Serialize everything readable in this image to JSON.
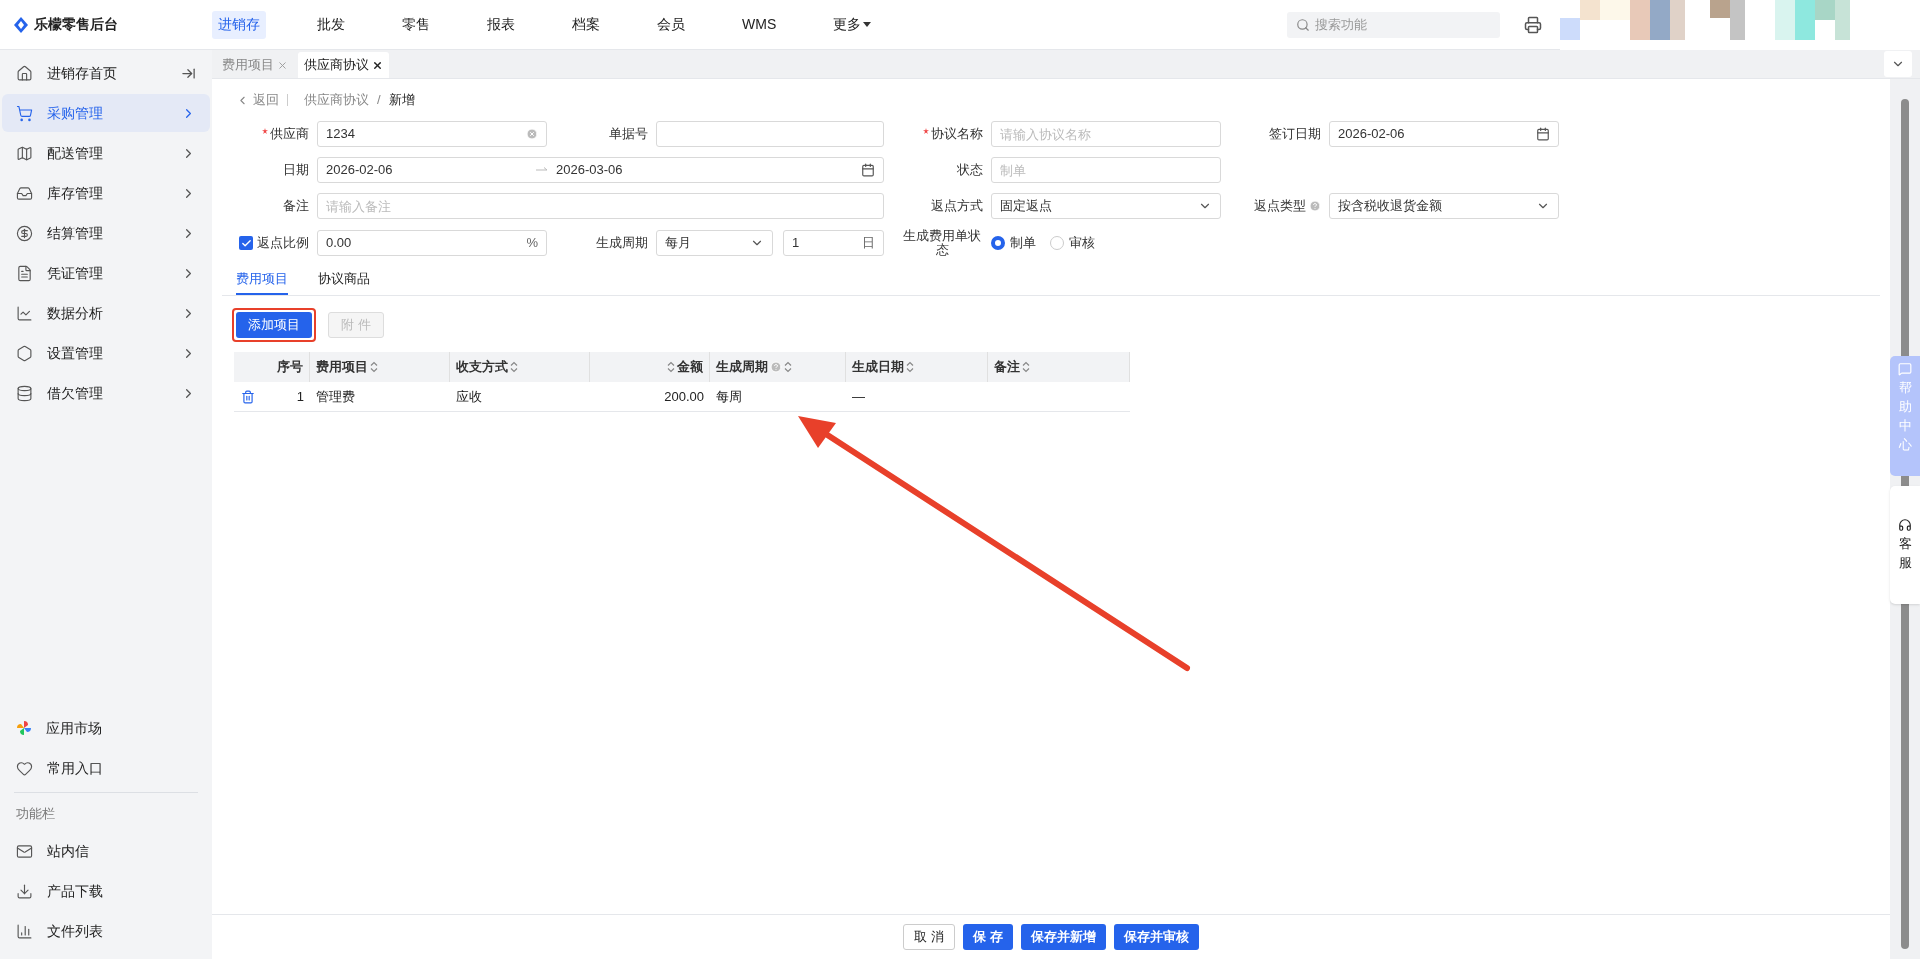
{
  "app": {
    "name": "乐檬零售后台"
  },
  "top_nav": [
    {
      "label": "进销存",
      "selected": true
    },
    {
      "label": "批发",
      "selected": false
    },
    {
      "label": "零售",
      "selected": false
    },
    {
      "label": "报表",
      "selected": false
    },
    {
      "label": "档案",
      "selected": false
    },
    {
      "label": "会员",
      "selected": false
    },
    {
      "label": "WMS",
      "selected": false
    },
    {
      "label": "更多",
      "selected": false,
      "dropdown": true
    }
  ],
  "search": {
    "placeholder": "搜索功能"
  },
  "sidebar": {
    "items": [
      {
        "label": "进销存首页",
        "selected": false
      },
      {
        "label": "采购管理",
        "selected": true
      },
      {
        "label": "配送管理",
        "selected": false
      },
      {
        "label": "库存管理",
        "selected": false
      },
      {
        "label": "结算管理",
        "selected": false
      },
      {
        "label": "凭证管理",
        "selected": false
      },
      {
        "label": "数据分析",
        "selected": false
      },
      {
        "label": "设置管理",
        "selected": false
      },
      {
        "label": "借欠管理",
        "selected": false
      }
    ],
    "bottom_items": [
      {
        "label": "应用市场"
      },
      {
        "label": "常用入口"
      }
    ],
    "section_title": "功能栏",
    "function_items": [
      {
        "label": "站内信"
      },
      {
        "label": "产品下载"
      },
      {
        "label": "文件列表"
      }
    ]
  },
  "page_tabs": [
    {
      "label": "费用项目",
      "selected": false
    },
    {
      "label": "供应商协议",
      "selected": true
    }
  ],
  "breadcrumb": {
    "back": "返回",
    "path": "供应商协议",
    "separator": "/",
    "current": "新增"
  },
  "form": {
    "supplier": {
      "label": "供应商",
      "required": true,
      "value": "1234"
    },
    "doc_no": {
      "label": "单据号"
    },
    "agreement_name": {
      "label": "协议名称",
      "required": true,
      "placeholder": "请输入协议名称"
    },
    "sign_date": {
      "label": "签订日期",
      "value": "2026-02-06"
    },
    "date": {
      "label": "日期",
      "start": "2026-02-06",
      "end": "2026-03-06"
    },
    "status": {
      "label": "状态",
      "placeholder": "制单"
    },
    "remark": {
      "label": "备注",
      "placeholder": "请输入备注"
    },
    "rebate_method": {
      "label": "返点方式",
      "value": "固定返点"
    },
    "rebate_type": {
      "label": "返点类型",
      "value": "按含税收退货金额"
    },
    "rebate_ratio": {
      "label": "返点比例",
      "checked": true,
      "value": "0.00",
      "suffix": "%"
    },
    "cycle": {
      "label": "生成周期",
      "value": "每月",
      "count": "1",
      "suffix": "日"
    },
    "bill_status": {
      "label": "生成费用单状态",
      "options": [
        {
          "label": "制单",
          "selected": true
        },
        {
          "label": "审核",
          "selected": false
        }
      ]
    }
  },
  "sub_tabs": [
    {
      "label": "费用项目",
      "selected": true
    },
    {
      "label": "协议商品",
      "selected": false
    }
  ],
  "actions": [
    {
      "label": "添加项目",
      "disabled": false,
      "highlighted": true
    },
    {
      "label": "附 件",
      "disabled": true,
      "highlighted": false
    }
  ],
  "table": {
    "columns": [
      {
        "label": "序号",
        "sortable": false
      },
      {
        "label": "费用项目",
        "sortable": true
      },
      {
        "label": "收支方式",
        "sortable": true
      },
      {
        "label": "金额",
        "sortable": true
      },
      {
        "label": "生成周期",
        "sortable": true,
        "help": true
      },
      {
        "label": "生成日期",
        "sortable": true
      },
      {
        "label": "备注",
        "sortable": true
      }
    ],
    "rows": [
      [
        "1",
        "管理费",
        "应收",
        "200.00",
        "每周",
        "—",
        ""
      ]
    ]
  },
  "footer_buttons": [
    {
      "label": "取 消",
      "primary": false
    },
    {
      "label": "保 存",
      "primary": true
    },
    {
      "label": "保存并新增",
      "primary": true
    },
    {
      "label": "保存并审核",
      "primary": true
    }
  ],
  "help_panel": {
    "help": "帮助中心",
    "service": "客服"
  }
}
